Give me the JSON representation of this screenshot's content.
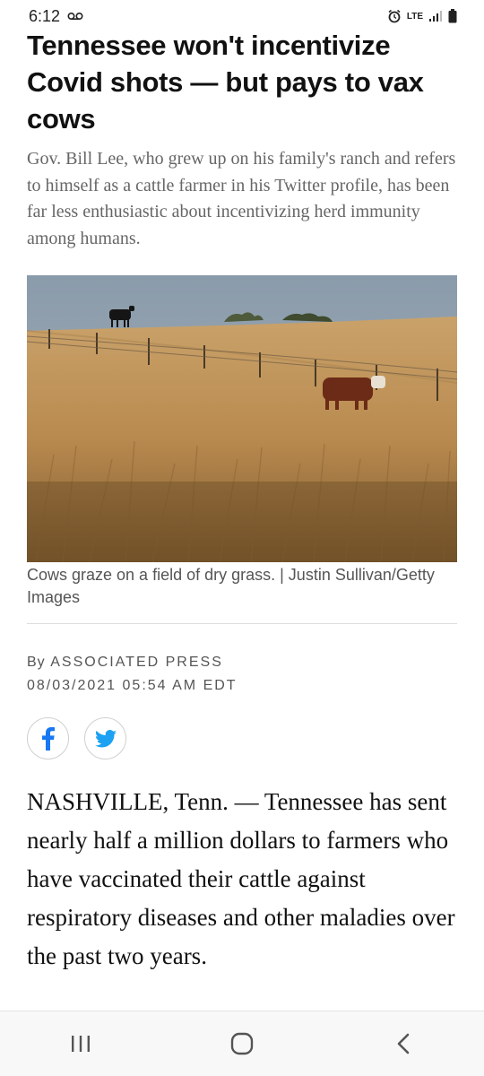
{
  "status_bar": {
    "time": "6:12",
    "voicemail_icon": "voicemail-icon",
    "alarm_icon": "alarm-icon",
    "network": "LTE",
    "signal_icon": "signal-icon",
    "battery_icon": "battery-icon"
  },
  "article": {
    "headline": "Tennessee won't incentivize Covid shots — but pays to vax cows",
    "dek": "Gov. Bill Lee, who grew up on his family's ranch and refers to himself as a cattle farmer in his Twitter profile, has been far less enthusiastic about incentivizing herd immunity among humans.",
    "photo_caption": "Cows graze on a field of dry grass. | Justin Sullivan/Getty Images",
    "byline_prefix": "By",
    "author": "ASSOCIATED PRESS",
    "timestamp": "08/03/2021 05:54 AM EDT",
    "share": {
      "facebook_icon": "facebook-icon",
      "twitter_icon": "twitter-icon"
    },
    "body": "NASHVILLE, Tenn. — Tennessee has sent nearly half a million dollars to farmers who have vaccinated their cattle against respiratory diseases and other maladies over the past two years."
  },
  "nav_bar": {
    "recents_icon": "recents-icon",
    "home_icon": "home-icon",
    "back_icon": "back-icon"
  },
  "colors": {
    "facebook": "#1877f2",
    "twitter": "#1da1f2",
    "text": "#111111",
    "dek": "#666666"
  }
}
